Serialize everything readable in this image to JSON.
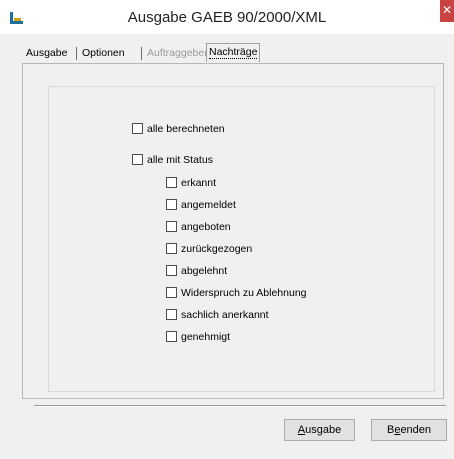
{
  "window": {
    "title": "Ausgabe GAEB 90/2000/XML",
    "close_glyph": "✕"
  },
  "tabs": [
    {
      "label": "Ausgabe",
      "state": "normal"
    },
    {
      "label": "Optionen",
      "state": "normal"
    },
    {
      "label": "Auftraggeber",
      "state": "disabled"
    },
    {
      "label": "Nachträge",
      "state": "selected"
    }
  ],
  "options": {
    "all_calculated": {
      "label": "alle berechneten",
      "checked": false
    },
    "all_with_status": {
      "label": "alle mit Status",
      "checked": false
    },
    "statuses": [
      {
        "label": "erkannt",
        "checked": false
      },
      {
        "label": "angemeldet",
        "checked": false
      },
      {
        "label": "angeboten",
        "checked": false
      },
      {
        "label": "zurückgezogen",
        "checked": false
      },
      {
        "label": "abgelehnt",
        "checked": false
      },
      {
        "label": "Widerspruch zu Ablehnung",
        "checked": false
      },
      {
        "label": "sachlich anerkannt",
        "checked": false
      },
      {
        "label": "genehmigt",
        "checked": false
      }
    ]
  },
  "buttons": {
    "output": {
      "mnemonic": "A",
      "rest": "usgabe"
    },
    "quit": {
      "pre": "B",
      "mnemonic": "e",
      "rest": "enden"
    }
  },
  "colors": {
    "dialog_bg": "#f0f0f0",
    "close_red": "#c94343"
  }
}
